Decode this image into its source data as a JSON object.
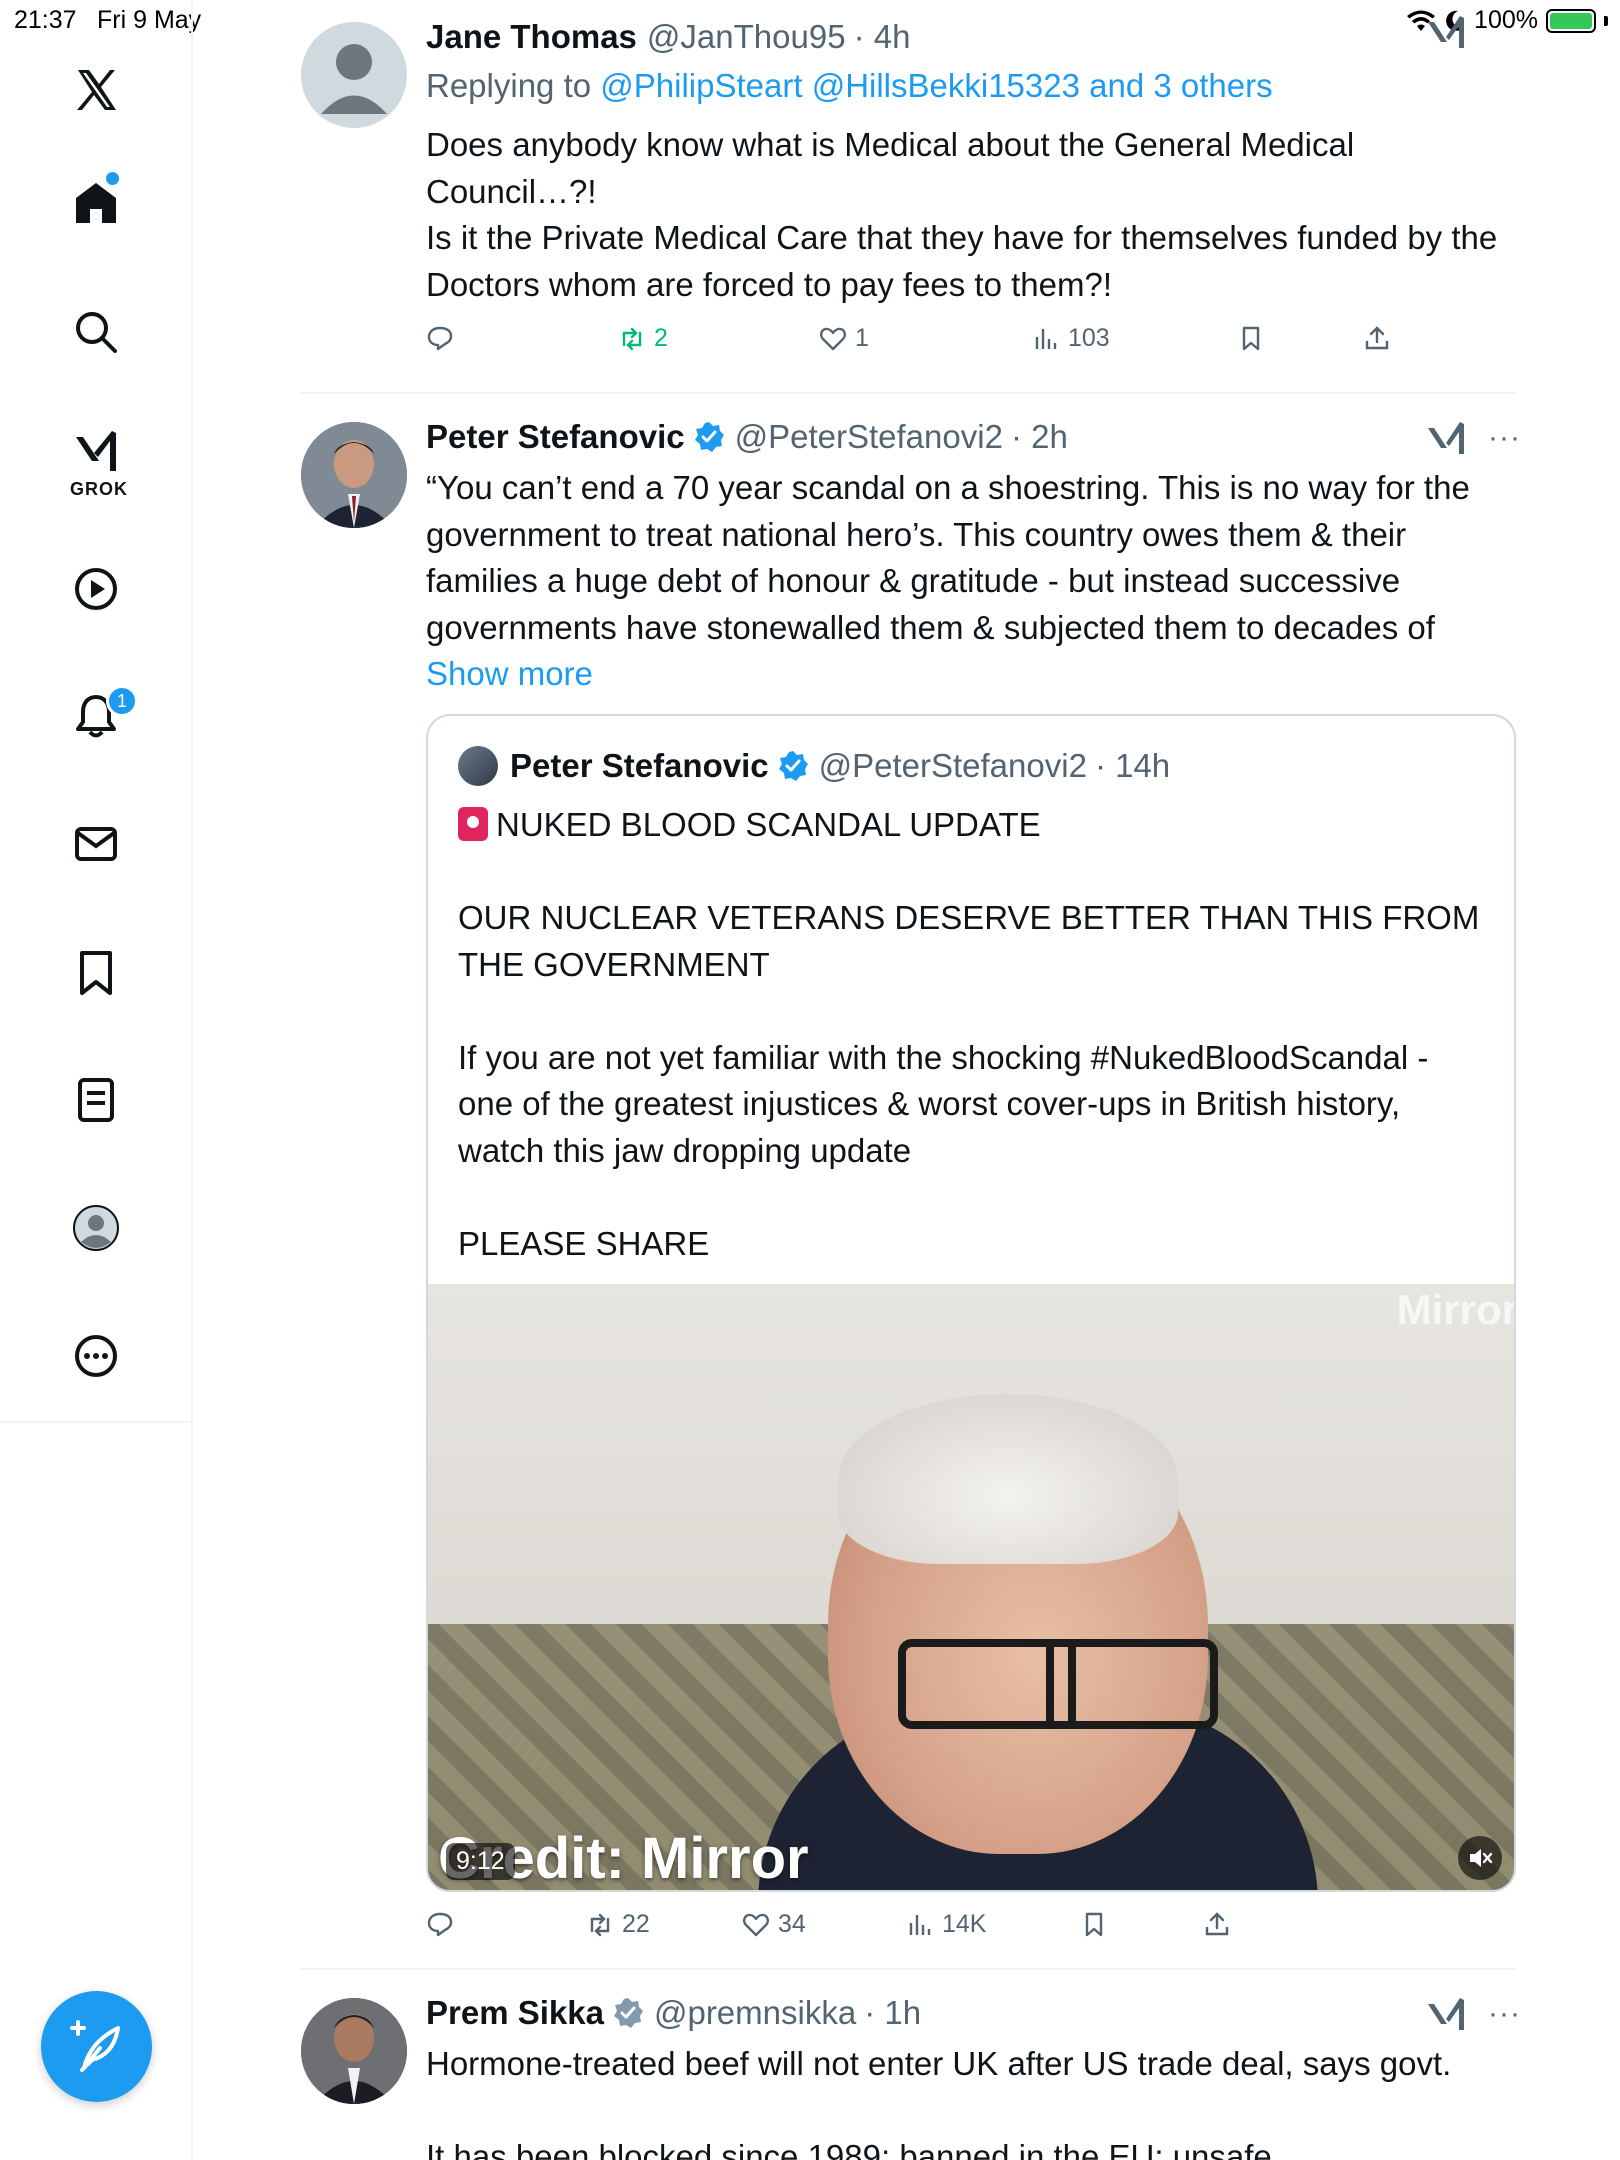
{
  "status_bar": {
    "time": "21:37",
    "date": "Fri 9 May",
    "battery": "100%"
  },
  "sidebar": {
    "items": [
      {
        "name": "x-logo"
      },
      {
        "name": "home",
        "has_dot": true
      },
      {
        "name": "explore"
      },
      {
        "name": "grok",
        "label": "GROK"
      },
      {
        "name": "video"
      },
      {
        "name": "notifications",
        "badge": "1"
      },
      {
        "name": "messages"
      },
      {
        "name": "bookmarks"
      },
      {
        "name": "lists"
      },
      {
        "name": "profile"
      },
      {
        "name": "more"
      }
    ],
    "compose_label": "Post"
  },
  "tweets": [
    {
      "name": "Jane Thomas",
      "handle": "@JanThou95",
      "time": "· 4h",
      "replying_prefix": "Replying to ",
      "replying_to": "@PhilipSteart @HillsBekki15323 and 3 others",
      "text": "Does anybody know what is Medical about the General Medical Council…?!\nIs it the Private Medical Care that they have for themselves funded by the Doctors whom are forced to pay fees to them?!",
      "stats": {
        "replies": "",
        "reposts": "2",
        "likes": "1",
        "views": "103"
      }
    },
    {
      "name": "Peter Stefanovic",
      "handle": "@PeterStefanovi2",
      "time": "· 2h",
      "text": "“You can’t end a 70 year scandal on a shoestring. This is no way for the government to treat national hero’s. This country owes them & their families a huge debt of honour & gratitude - but instead successive governments have stonewalled them & subjected them to decades of ",
      "show_more": "Show more",
      "stats": {
        "replies": "",
        "reposts": "22",
        "likes": "34",
        "views": "14K"
      },
      "quote": {
        "name": "Peter Stefanovic",
        "handle": "@PeterStefanovi2",
        "time": "· 14h",
        "text": "NUKED BLOOD SCANDAL UPDATE\n\nOUR NUCLEAR VETERANS DESERVE BETTER THAN THIS FROM THE GOVERNMENT\n\nIf you are not yet familiar with the shocking #NukedBloodScandal - one of the greatest injustices & worst cover-ups in British history, watch this jaw dropping update\n\nPLEASE SHARE",
        "video": {
          "watermark": "Mirror",
          "credit": "Credit: Mirror",
          "duration": "9:12"
        }
      }
    },
    {
      "name": "Prem Sikka",
      "handle": "@premnsikka",
      "time": "· 1h",
      "text": "Hormone-treated beef will not enter UK after US trade deal, says govt.\n\nIt has been blocked since 1989; banned in the EU; unsafe"
    }
  ],
  "colors": {
    "accent": "#1d9bf0",
    "repost_green": "#00ba7c",
    "muted": "#536471"
  }
}
